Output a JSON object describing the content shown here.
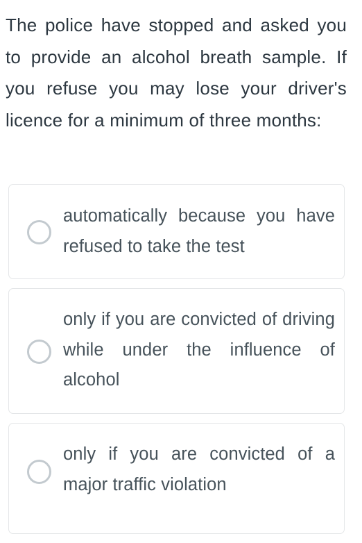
{
  "question": {
    "text": "The police have stopped and asked you to provide an alcohol breath sample. If you refuse you may lose your driver's licence for a minimum of three months:"
  },
  "options": [
    {
      "label": "automatically because you have refused to take the test",
      "selected": false
    },
    {
      "label": "only if you are convicted of driving while under the influence of alcohol",
      "selected": false
    },
    {
      "label": "only if you are convicted of a major traffic violation",
      "selected": false
    }
  ],
  "colors": {
    "question_text": "#2c3740",
    "option_text": "#46525a",
    "card_border": "#e4e6e8",
    "radio_border": "#c3cacf",
    "background": "#ffffff"
  }
}
